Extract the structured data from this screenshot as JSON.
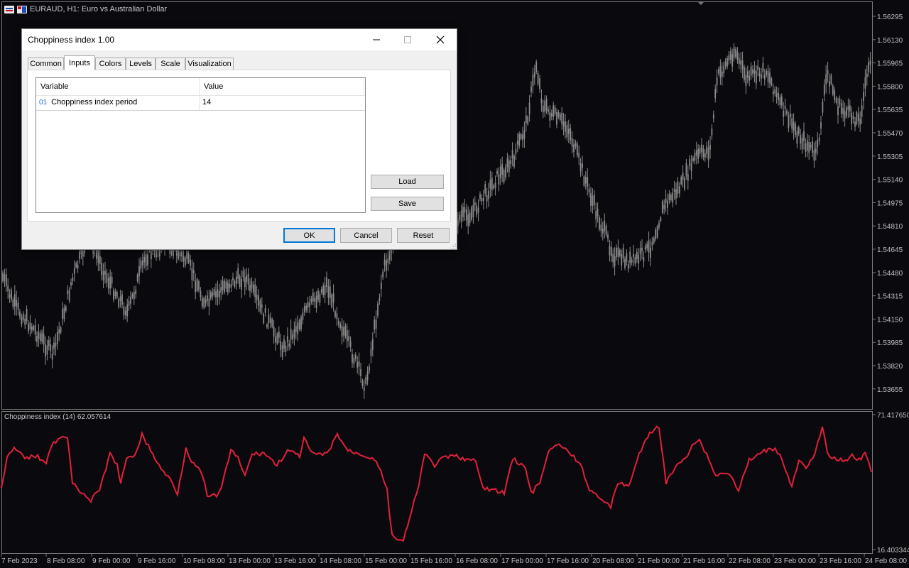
{
  "chart": {
    "symbol_title": "EURAUD, H1:  Euro vs Australian Dollar",
    "subwindow_title": "Choppiness index (14) 62.057614",
    "price_axis": [
      "1.56295",
      "1.56130",
      "1.55965",
      "1.55800",
      "1.55635",
      "1.55470",
      "1.55305",
      "1.55140",
      "1.54975",
      "1.54810",
      "1.54645",
      "1.54480",
      "1.54315",
      "1.54150",
      "1.53985",
      "1.53820",
      "1.53655"
    ],
    "indicator_axis": [
      "71.417650",
      "16.403344"
    ],
    "time_axis": [
      "7 Feb 2023",
      "8 Feb 08:00",
      "9 Feb 00:00",
      "9 Feb 16:00",
      "10 Feb 08:00",
      "13 Feb 00:00",
      "13 Feb 16:00",
      "14 Feb 08:00",
      "15 Feb 00:00",
      "15 Feb 16:00",
      "16 Feb 08:00",
      "17 Feb 00:00",
      "17 Feb 16:00",
      "20 Feb 08:00",
      "21 Feb 00:00",
      "21 Feb 16:00",
      "22 Feb 08:00",
      "23 Feb 00:00",
      "23 Feb 16:00",
      "24 Feb 08:00"
    ],
    "colors": {
      "background": "#0a0a0e",
      "candles": "#8c8c8c",
      "indicator_line": "#e0203a",
      "axis_text": "#c0c0c0"
    }
  },
  "dialog": {
    "title": "Choppiness index 1.00",
    "tabs": [
      "Common",
      "Inputs",
      "Colors",
      "Levels",
      "Scale",
      "Visualization"
    ],
    "active_tab": "Inputs",
    "grid": {
      "headers": {
        "variable": "Variable",
        "value": "Value"
      },
      "rows": [
        {
          "index": "01",
          "variable": "Choppiness index period",
          "value": "14"
        }
      ]
    },
    "buttons": {
      "load": "Load",
      "save": "Save",
      "ok": "OK",
      "cancel": "Cancel",
      "reset": "Reset"
    }
  }
}
